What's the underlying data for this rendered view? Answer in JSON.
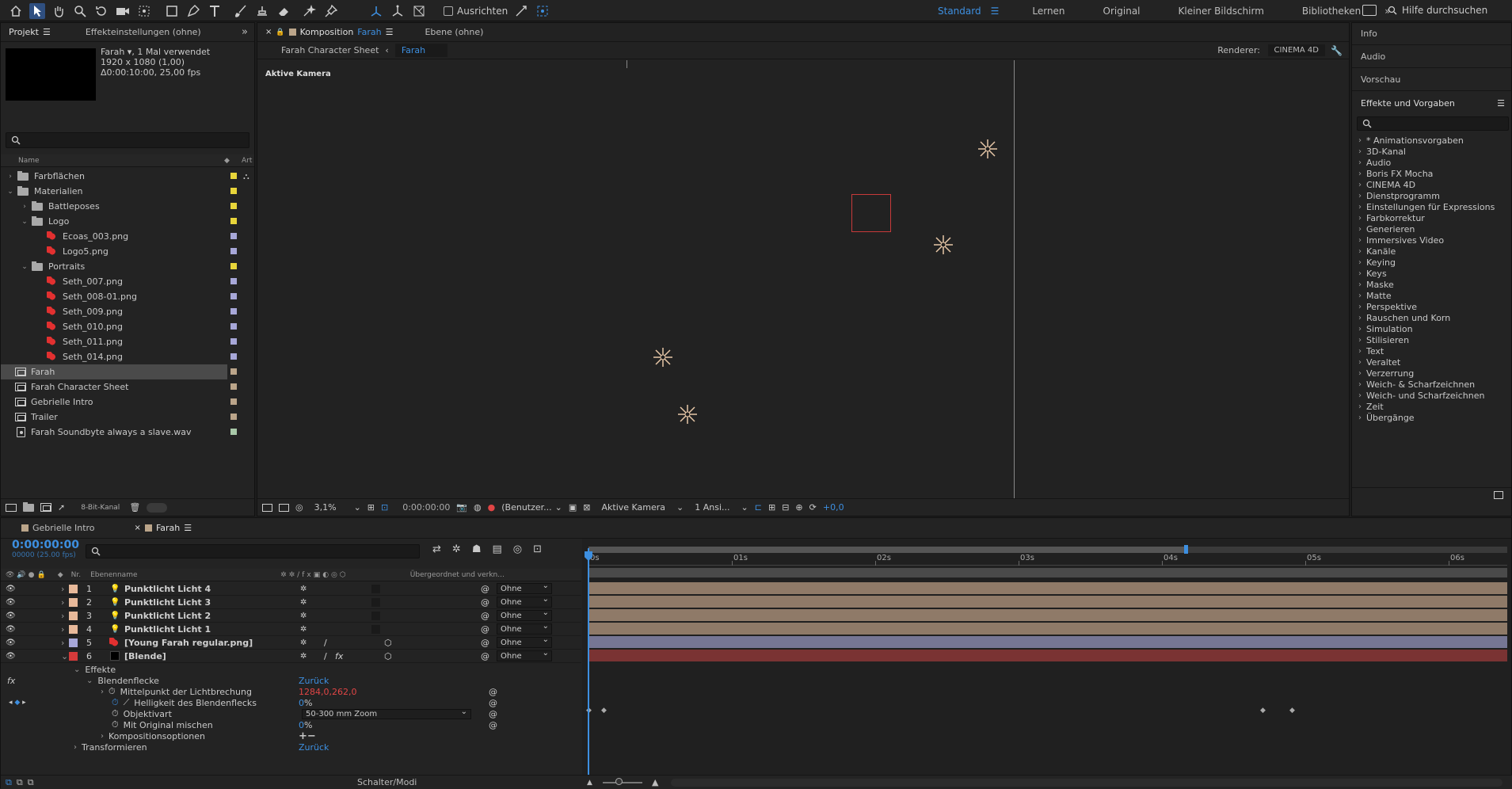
{
  "toolbar": {
    "snap_label": "Ausrichten",
    "workspaces": [
      "Standard",
      "Lernen",
      "Original",
      "Kleiner Bildschirm",
      "Bibliotheken"
    ],
    "active_workspace": "Standard",
    "help_placeholder": "Hilfe durchsuchen"
  },
  "project": {
    "tab_project": "Projekt",
    "tab_effects": "Effekteinstellungen (ohne)",
    "selected_name": "Farah",
    "selected_usage": ", 1 Mal verwendet",
    "selected_res": "1920 x 1080 (1,00)",
    "selected_dur": "Δ0:00:10:00, 25,00 fps",
    "col_name": "Name",
    "col_type": "Art",
    "items": [
      {
        "name": "Farbflächen",
        "kind": "folder",
        "indent": 0,
        "open": false,
        "color": "#e8d53a"
      },
      {
        "name": "Materialien",
        "kind": "folder",
        "indent": 0,
        "open": true,
        "color": "#e8d53a"
      },
      {
        "name": "Battleposes",
        "kind": "folder",
        "indent": 1,
        "open": false,
        "color": "#e8d53a"
      },
      {
        "name": "Logo",
        "kind": "folder",
        "indent": 1,
        "open": true,
        "color": "#e8d53a"
      },
      {
        "name": "Ecoas_003.png",
        "kind": "image",
        "indent": 2,
        "color": "#a7a7d8"
      },
      {
        "name": "Logo5.png",
        "kind": "image",
        "indent": 2,
        "color": "#a7a7d8"
      },
      {
        "name": "Portraits",
        "kind": "folder",
        "indent": 1,
        "open": true,
        "color": "#e8d53a"
      },
      {
        "name": "Seth_007.png",
        "kind": "image",
        "indent": 2,
        "color": "#a7a7d8"
      },
      {
        "name": "Seth_008-01.png",
        "kind": "image",
        "indent": 2,
        "color": "#a7a7d8"
      },
      {
        "name": "Seth_009.png",
        "kind": "image",
        "indent": 2,
        "color": "#a7a7d8"
      },
      {
        "name": "Seth_010.png",
        "kind": "image",
        "indent": 2,
        "color": "#a7a7d8"
      },
      {
        "name": "Seth_011.png",
        "kind": "image",
        "indent": 2,
        "color": "#a7a7d8"
      },
      {
        "name": "Seth_014.png",
        "kind": "image",
        "indent": 2,
        "color": "#a7a7d8"
      },
      {
        "name": "Farah",
        "kind": "comp",
        "indent": 0,
        "selected": true,
        "color": "#bba58a"
      },
      {
        "name": "Farah Character Sheet",
        "kind": "comp",
        "indent": 0,
        "color": "#bba58a"
      },
      {
        "name": "Gebrielle Intro",
        "kind": "comp",
        "indent": 0,
        "color": "#bba58a"
      },
      {
        "name": "Trailer",
        "kind": "comp",
        "indent": 0,
        "color": "#bba58a"
      },
      {
        "name": "Farah Soundbyte always a slave.wav",
        "kind": "audio",
        "indent": 0,
        "color": "#a8c8a8"
      }
    ],
    "bit_depth": "8-Bit-Kanal"
  },
  "composition": {
    "tab_label": "Komposition",
    "tab_comp": "Farah",
    "tab_layer": "Ebene (ohne)",
    "crumb_parent": "Farah Character Sheet",
    "crumb_current": "Farah",
    "renderer_label": "Renderer:",
    "renderer_value": "CINEMA 4D",
    "viewer_label": "Aktive Kamera",
    "zoom": "3,1%",
    "timecode": "0:00:00:00",
    "view_mode": "(Benutzer...",
    "camera": "Aktive Kamera",
    "views": "1 Ansi...",
    "exposure": "+0,0"
  },
  "right_panel": {
    "sections": [
      "Info",
      "Audio",
      "Vorschau"
    ],
    "effects_title": "Effekte und Vorgaben",
    "effects": [
      "* Animationsvorgaben",
      "3D-Kanal",
      "Audio",
      "Boris FX Mocha",
      "CINEMA 4D",
      "Dienstprogramm",
      "Einstellungen für Expressions",
      "Farbkorrektur",
      "Generieren",
      "Immersives Video",
      "Kanäle",
      "Keying",
      "Keys",
      "Maske",
      "Matte",
      "Perspektive",
      "Rauschen und Korn",
      "Simulation",
      "Stilisieren",
      "Text",
      "Veraltet",
      "Verzerrung",
      "Weich- & Scharfzeichnen",
      "Weich- und Scharfzeichnen",
      "Zeit",
      "Übergänge"
    ]
  },
  "timeline": {
    "tabs": [
      "Gebrielle Intro",
      "Farah"
    ],
    "active_tab": "Farah",
    "timecode": "0:00:00:00",
    "timecode_sub": "00000 (25.00 fps)",
    "col_nr": "Nr.",
    "col_name": "Ebenenname",
    "col_parent": "Übergeordnet und verkn...",
    "ruler": [
      "0s",
      "01s",
      "02s",
      "03s",
      "04s",
      "05s",
      "06s"
    ],
    "layers": [
      {
        "nr": "1",
        "name": "Punktlicht Licht 4",
        "kind": "light",
        "color": "#e8b99a",
        "parent": "Ohne",
        "bar": "#8f7a68"
      },
      {
        "nr": "2",
        "name": "Punktlicht Licht 3",
        "kind": "light",
        "color": "#e8b99a",
        "parent": "Ohne",
        "bar": "#8f7a68"
      },
      {
        "nr": "3",
        "name": "Punktlicht Licht 2",
        "kind": "light",
        "color": "#e8b99a",
        "parent": "Ohne",
        "bar": "#8f7a68"
      },
      {
        "nr": "4",
        "name": "Punktlicht Licht 1",
        "kind": "light",
        "color": "#e8b99a",
        "parent": "Ohne",
        "bar": "#8f7a68"
      },
      {
        "nr": "5",
        "name": "[Young Farah regular.png]",
        "kind": "image",
        "color": "#a7a7d8",
        "parent": "Ohne",
        "bar": "#767694"
      },
      {
        "nr": "6",
        "name": "[Blende]",
        "kind": "solid",
        "color": "#d43a3a",
        "parent": "Ohne",
        "bar": "#7a3333"
      }
    ],
    "props": {
      "effects": "Effekte",
      "lens_flare": "Blendenflecke",
      "reset": "Zurück",
      "center_label": "Mittelpunkt der Lichtbrechung",
      "center_value": "1284,0,262,0",
      "brightness_label": "Helligkeit des Blendenflecks",
      "brightness_value": "0",
      "percent": "%",
      "lens_label": "Objektivart",
      "lens_value": "50-300 mm Zoom",
      "blend_label": "Mit Original mischen",
      "blend_value": "0",
      "comp_options": "Kompositionsoptionen",
      "transform": "Transformieren",
      "transform_reset": "Zurück"
    },
    "footer": "Schalter/Modi"
  },
  "colors": {
    "accent": "#3d8fe0",
    "panel": "#232323",
    "light_star": "#e8c8a8",
    "flare_box": "#c83a3a"
  }
}
